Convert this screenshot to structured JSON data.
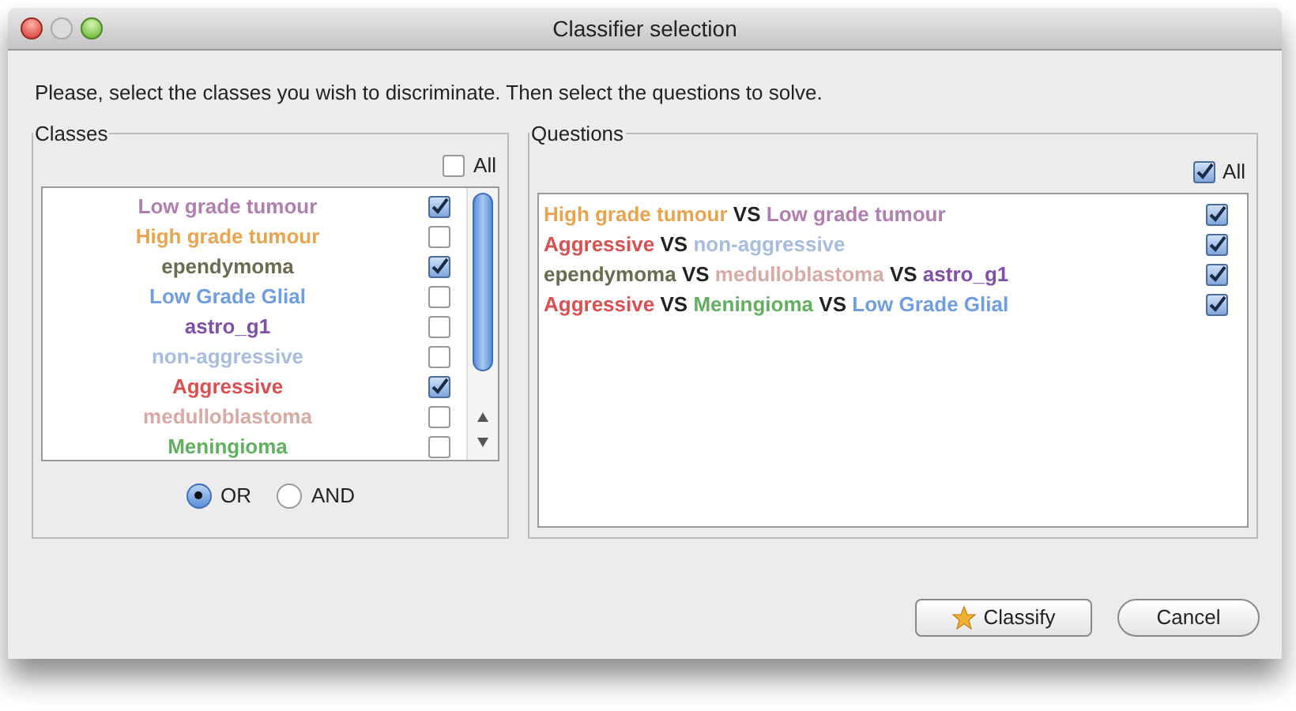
{
  "window": {
    "title": "Classifier selection"
  },
  "instructions": "Please, select the classes you wish to discriminate. Then select the questions to solve.",
  "classes": {
    "title": "Classes",
    "all": {
      "label": "All",
      "checked": false
    },
    "items": [
      {
        "label": "Low grade tumour",
        "color": "#b07fb0",
        "checked": true
      },
      {
        "label": "High grade tumour",
        "color": "#e8a550",
        "checked": false
      },
      {
        "label": "ependymoma",
        "color": "#6b6b50",
        "checked": true
      },
      {
        "label": "Low Grade Glial",
        "color": "#6f9ee0",
        "checked": false
      },
      {
        "label": "astro_g1",
        "color": "#8050a8",
        "checked": false
      },
      {
        "label": "non-aggressive",
        "color": "#a8bce0",
        "checked": false
      },
      {
        "label": "Aggressive",
        "color": "#d85050",
        "checked": true
      },
      {
        "label": "medulloblastoma",
        "color": "#d8aaa4",
        "checked": false
      },
      {
        "label": "Meningioma",
        "color": "#60b060",
        "checked": false
      }
    ],
    "modes": [
      {
        "label": "OR",
        "selected": true
      },
      {
        "label": "AND",
        "selected": false
      }
    ]
  },
  "questions": {
    "title": "Questions",
    "all": {
      "label": "All",
      "checked": true
    },
    "items": [
      {
        "checked": true,
        "parts": [
          {
            "text": "High grade tumour",
            "color": "#e8a550"
          },
          {
            "text": "VS",
            "color": "#222222"
          },
          {
            "text": "Low grade tumour",
            "color": "#b07fb0"
          }
        ]
      },
      {
        "checked": true,
        "parts": [
          {
            "text": "Aggressive",
            "color": "#d85050"
          },
          {
            "text": "VS",
            "color": "#222222"
          },
          {
            "text": "non-aggressive",
            "color": "#a8bce0"
          }
        ]
      },
      {
        "checked": true,
        "parts": [
          {
            "text": "ependymoma",
            "color": "#6b6b50"
          },
          {
            "text": "VS",
            "color": "#222222"
          },
          {
            "text": "medulloblastoma",
            "color": "#d8aaa4"
          },
          {
            "text": "VS",
            "color": "#222222"
          },
          {
            "text": "astro_g1",
            "color": "#8050a8"
          }
        ]
      },
      {
        "checked": true,
        "parts": [
          {
            "text": "Aggressive",
            "color": "#d85050"
          },
          {
            "text": "VS",
            "color": "#222222"
          },
          {
            "text": "Meningioma",
            "color": "#60b060"
          },
          {
            "text": "VS",
            "color": "#222222"
          },
          {
            "text": "Low Grade Glial",
            "color": "#6f9ee0"
          }
        ]
      }
    ]
  },
  "buttons": [
    {
      "label": "Classify",
      "kind": "star"
    },
    {
      "label": "Cancel",
      "kind": "plain"
    }
  ]
}
